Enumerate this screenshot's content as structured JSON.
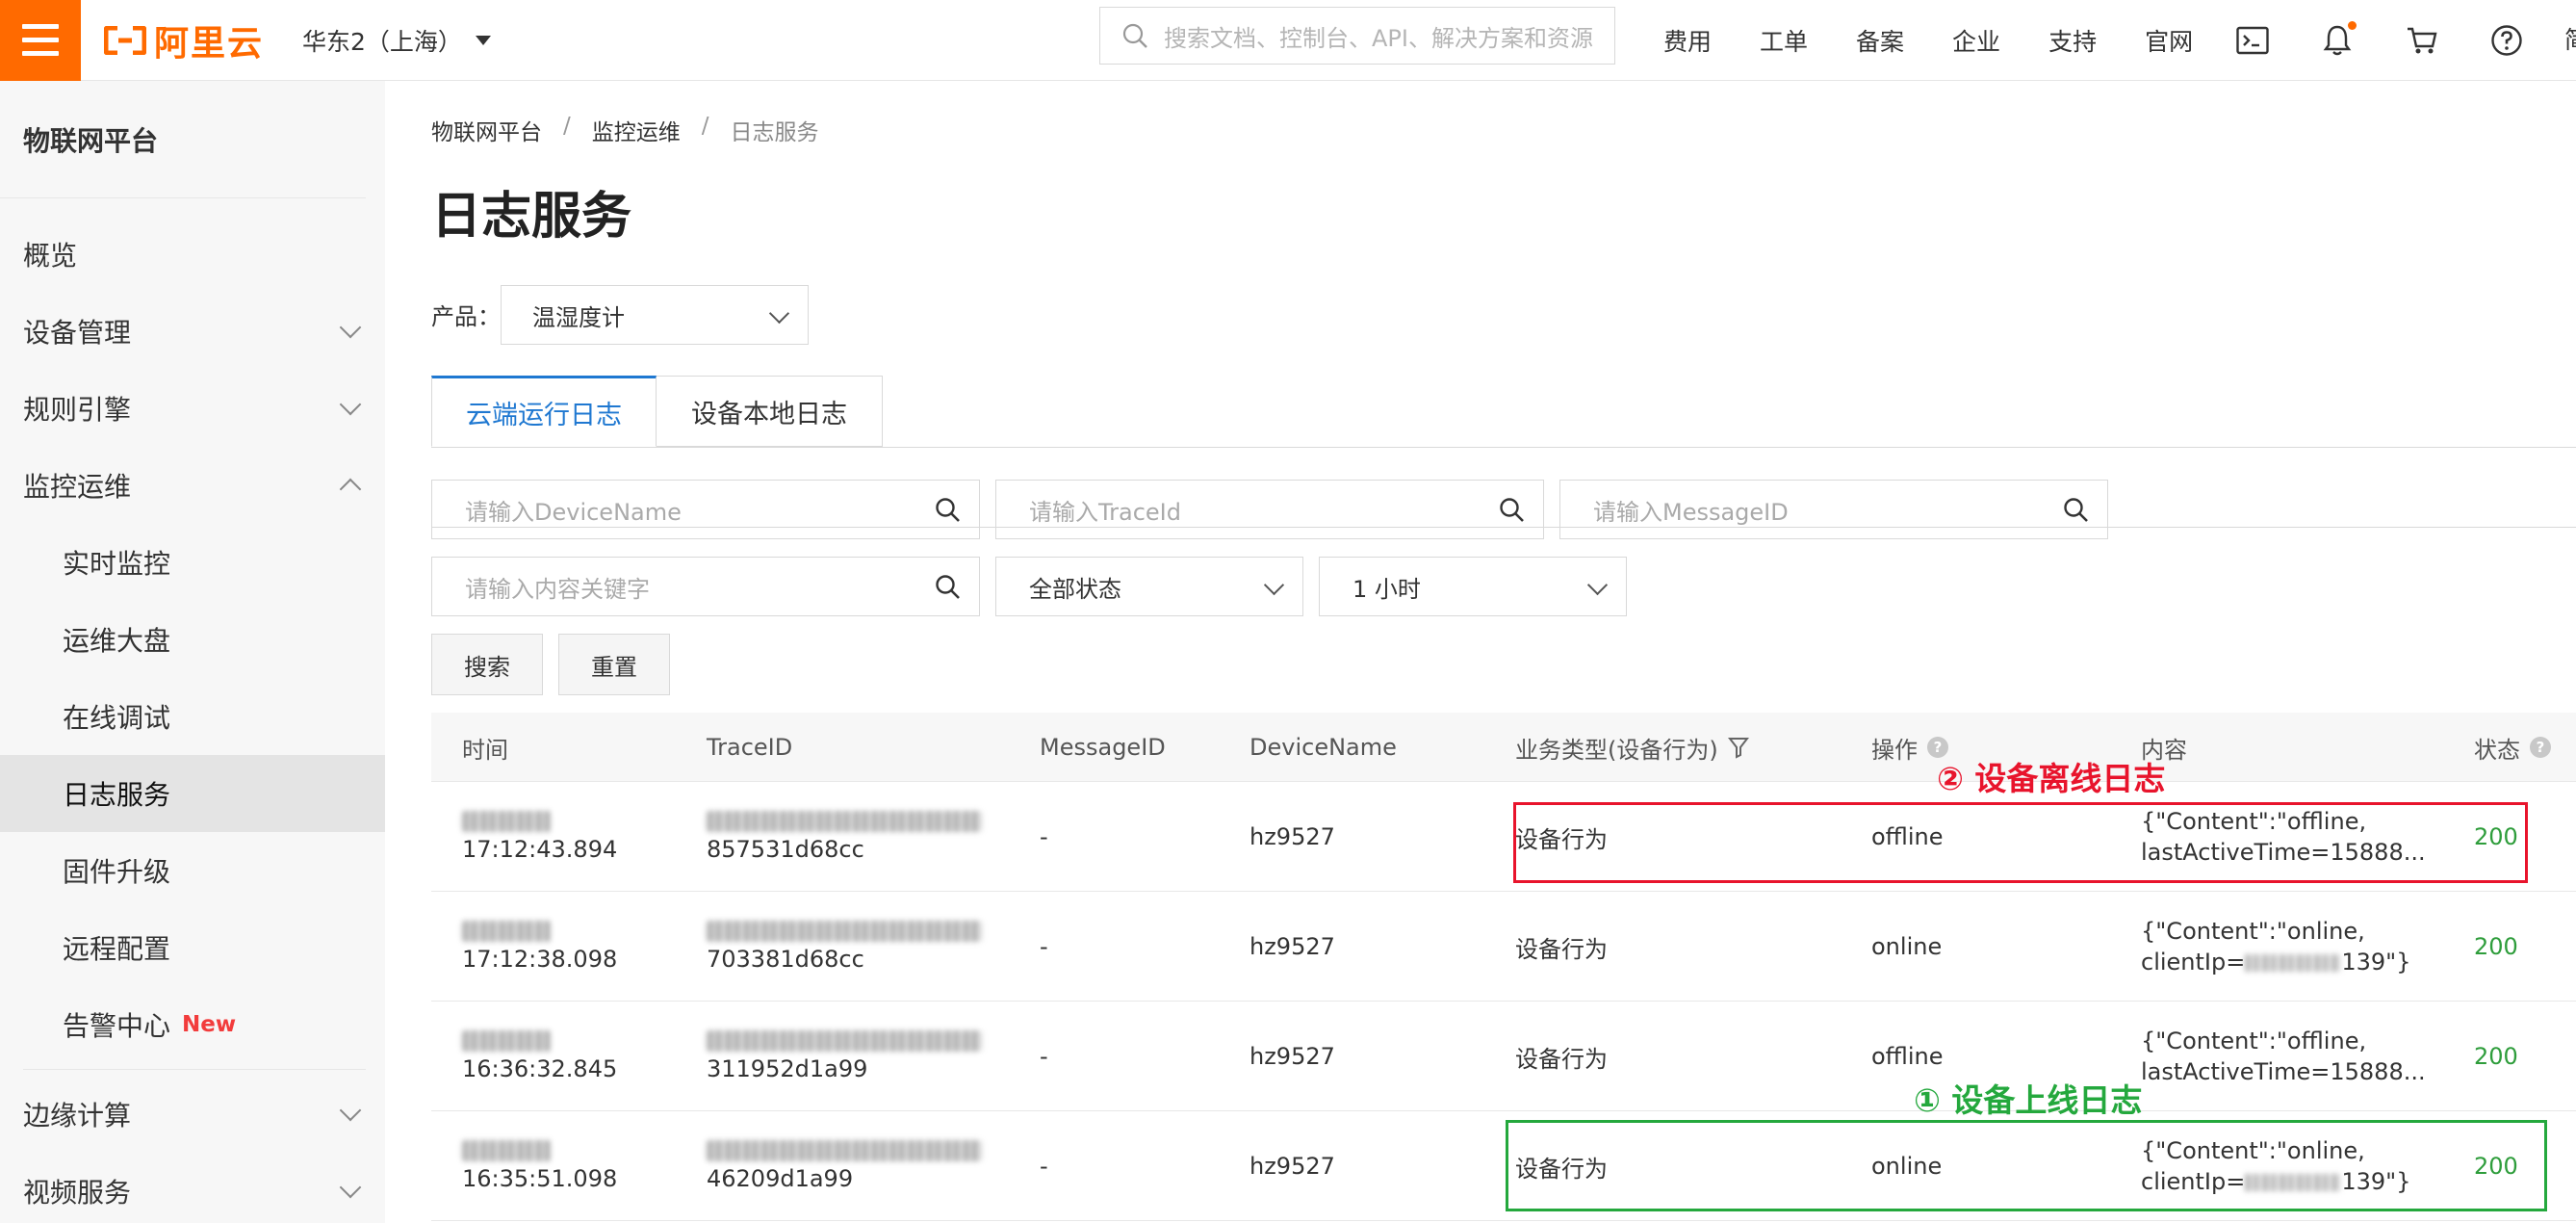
{
  "brand": {
    "name": "阿里云",
    "accent_color": "#ff6a00"
  },
  "topbar": {
    "region": "华东2（上海）",
    "search_placeholder": "搜索文档、控制台、API、解决方案和资源",
    "nav": [
      "费用",
      "工单",
      "备案",
      "企业",
      "支持",
      "官网"
    ],
    "icons": [
      "terminal-icon",
      "bell-icon",
      "cart-icon",
      "help-icon"
    ],
    "cut_text": "简"
  },
  "sidebar": {
    "title": "物联网平台",
    "items": [
      {
        "label": "概览"
      },
      {
        "label": "设备管理",
        "expandable": true
      },
      {
        "label": "规则引擎",
        "expandable": true
      },
      {
        "label": "监控运维",
        "expanded": true
      },
      {
        "label": "实时监控"
      },
      {
        "label": "运维大盘"
      },
      {
        "label": "在线调试"
      },
      {
        "label": "日志服务",
        "active": true
      },
      {
        "label": "固件升级"
      },
      {
        "label": "远程配置"
      },
      {
        "label": "告警中心",
        "badge": "New"
      },
      {
        "label": "边缘计算",
        "expandable": true
      },
      {
        "label": "视频服务",
        "expandable": true
      }
    ]
  },
  "breadcrumb": [
    "物联网平台",
    "监控运维",
    "日志服务"
  ],
  "page_title": "日志服务",
  "product": {
    "label": "产品：",
    "value": "温湿度计"
  },
  "tabs": [
    {
      "label": "云端运行日志",
      "active": true
    },
    {
      "label": "设备本地日志"
    }
  ],
  "filters": {
    "device_name_placeholder": "请输入DeviceName",
    "trace_id_placeholder": "请输入TraceId",
    "message_id_placeholder": "请输入MessageID",
    "keyword_placeholder": "请输入内容关键字",
    "status_value": "全部状态",
    "time_value": "1 小时",
    "search_button": "搜索",
    "reset_button": "重置"
  },
  "table": {
    "columns": [
      "时间",
      "TraceID",
      "MessageID",
      "DeviceName",
      "业务类型(设备行为)",
      "操作",
      "内容",
      "状态"
    ],
    "rows": [
      {
        "time": "17:12:43.894",
        "trace": "857531d68cc",
        "message_id": "-",
        "device": "hz9527",
        "biz": "设备行为",
        "action": "offline",
        "content1": "{\"Content\":\"offline,",
        "content2": "lastActiveTime=15888...",
        "status": "200"
      },
      {
        "time": "17:12:38.098",
        "trace": "703381d68cc",
        "message_id": "-",
        "device": "hz9527",
        "biz": "设备行为",
        "action": "online",
        "content1": "{\"Content\":\"online,",
        "content2a": "clientIp=",
        "content2b": "139\"}",
        "status": "200"
      },
      {
        "time": "16:36:32.845",
        "trace": "311952d1a99",
        "message_id": "-",
        "device": "hz9527",
        "biz": "设备行为",
        "action": "offline",
        "content1": "{\"Content\":\"offline,",
        "content2": "lastActiveTime=15888...",
        "status": "200"
      },
      {
        "time": "16:35:51.098",
        "trace": "46209d1a99",
        "message_id": "-",
        "device": "hz9527",
        "biz": "设备行为",
        "action": "online",
        "content1": "{\"Content\":\"online,",
        "content2a": "clientIp=",
        "content2b": "139\"}",
        "status": "200"
      }
    ]
  },
  "annotations": {
    "offline_label": "② 设备离线日志",
    "online_label": "① 设备上线日志",
    "offline_color": "#e8142c",
    "online_color": "#24a83d"
  }
}
